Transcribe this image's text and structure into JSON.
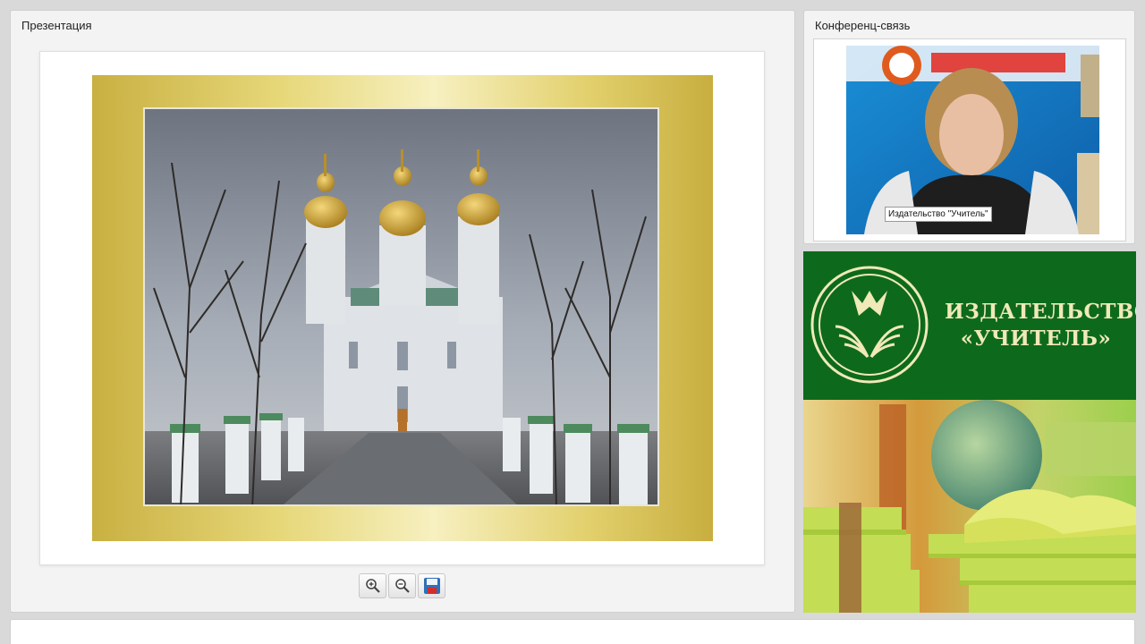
{
  "presentation": {
    "title": "Презентация",
    "toolbar": [
      {
        "name": "zoom-in-button",
        "icon": "zoom-in-icon"
      },
      {
        "name": "zoom-out-button",
        "icon": "zoom-out-icon"
      },
      {
        "name": "save-button",
        "icon": "save-icon"
      }
    ]
  },
  "conference": {
    "title": "Конференц-связь",
    "speaker_label": "Издательство \"Учитель\""
  },
  "banner": {
    "line1": "ИЗДАТЕЛЬСТВО",
    "line2": "«УЧИТЕЛЬ»",
    "logo_icon": "open-book-logo-icon"
  },
  "colors": {
    "panel_bg": "#f3f3f3",
    "banner_green": "#0d6a1d",
    "banner_text": "#f0e9b8",
    "gold_frame": "#e6d778"
  }
}
